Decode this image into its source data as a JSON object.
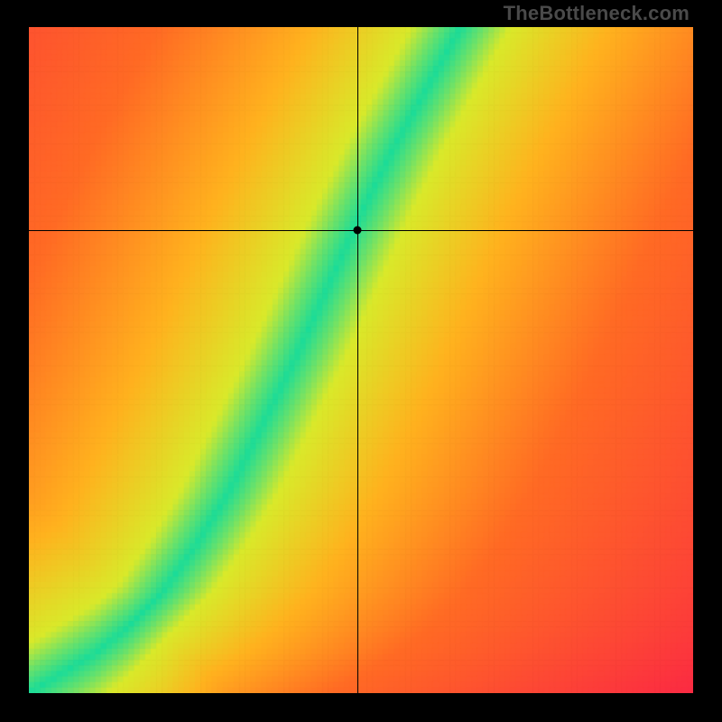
{
  "watermark": "TheBottleneck.com",
  "chart_data": {
    "type": "heatmap",
    "title": "",
    "xlabel": "",
    "ylabel": "",
    "xlim": [
      0,
      1
    ],
    "ylim": [
      0,
      1
    ],
    "crosshair": {
      "x": 0.495,
      "y": 0.695
    },
    "marker": {
      "x": 0.495,
      "y": 0.695
    },
    "optimal_curve": [
      {
        "x": 0.0,
        "y": 0.0
      },
      {
        "x": 0.05,
        "y": 0.03
      },
      {
        "x": 0.1,
        "y": 0.06
      },
      {
        "x": 0.15,
        "y": 0.1
      },
      {
        "x": 0.2,
        "y": 0.15
      },
      {
        "x": 0.25,
        "y": 0.22
      },
      {
        "x": 0.3,
        "y": 0.3
      },
      {
        "x": 0.35,
        "y": 0.4
      },
      {
        "x": 0.4,
        "y": 0.5
      },
      {
        "x": 0.45,
        "y": 0.61
      },
      {
        "x": 0.5,
        "y": 0.72
      },
      {
        "x": 0.55,
        "y": 0.82
      },
      {
        "x": 0.6,
        "y": 0.91
      },
      {
        "x": 0.65,
        "y": 1.0
      }
    ],
    "band_half_width": 0.035,
    "gradient_colors": {
      "optimal": "#1bdc98",
      "near": "#d9e92a",
      "mid": "#ffb21e",
      "far": "#ff6a24",
      "worst": "#fb2943"
    },
    "grid_resolution": 120
  }
}
